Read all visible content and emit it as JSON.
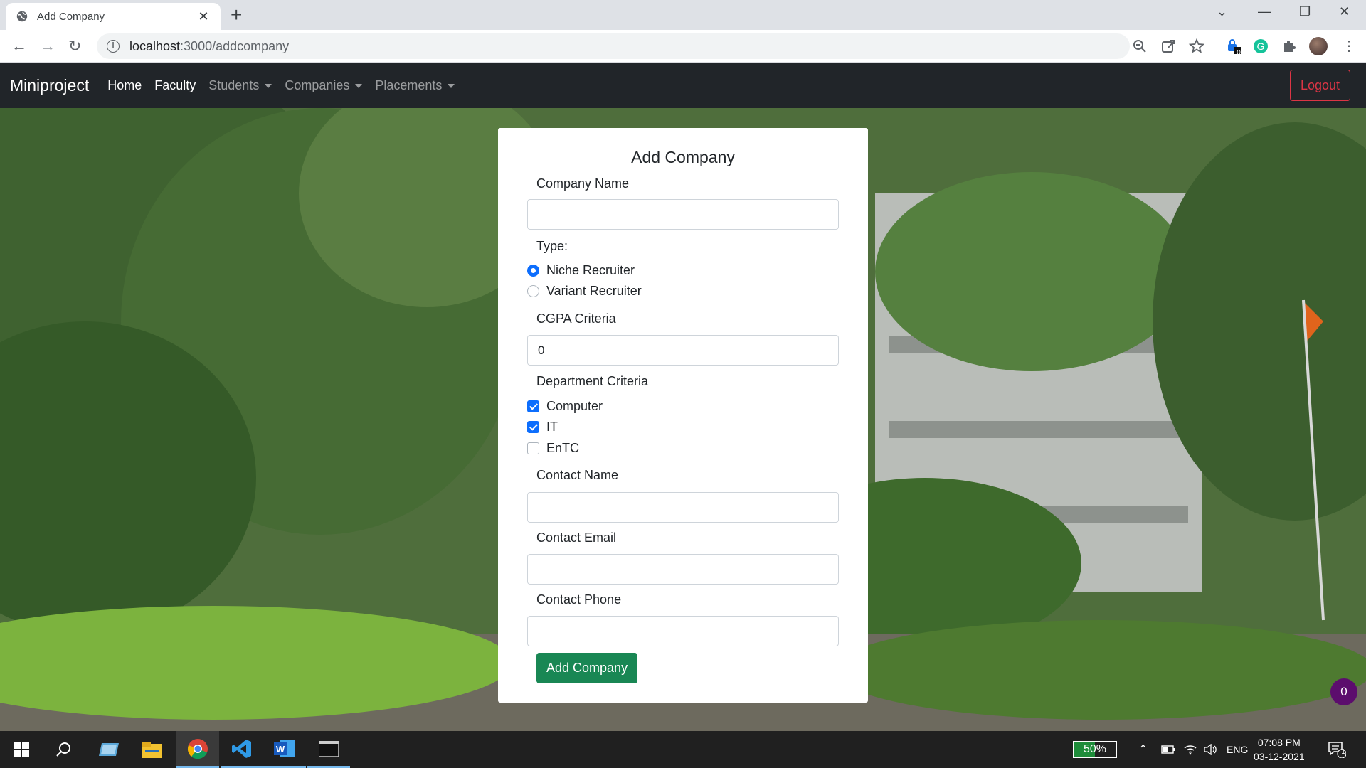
{
  "browser": {
    "tab_title": "Add Company",
    "url_host": "localhost",
    "url_rest": ":3000/addcompany",
    "extension_badge": "0"
  },
  "navbar": {
    "brand": "Miniproject",
    "links": [
      "Home",
      "Faculty",
      "Students",
      "Companies",
      "Placements"
    ],
    "logout": "Logout"
  },
  "form": {
    "title": "Add Company",
    "company_name_label": "Company Name",
    "company_name_value": "",
    "type_label": "Type:",
    "type_options": [
      "Niche Recruiter",
      "Variant Recruiter"
    ],
    "type_selected": "Niche Recruiter",
    "cgpa_label": "CGPA Criteria",
    "cgpa_value": "0",
    "department_label": "Department Criteria",
    "departments": [
      {
        "label": "Computer",
        "checked": true
      },
      {
        "label": "IT",
        "checked": true
      },
      {
        "label": "EnTC",
        "checked": false
      }
    ],
    "contact_name_label": "Contact Name",
    "contact_email_label": "Contact Email",
    "contact_phone_label": "Contact Phone",
    "submit_label": "Add Company"
  },
  "floating_badge": "0",
  "taskbar": {
    "battery": "50%",
    "language": "ENG",
    "time": "07:08 PM",
    "date": "03-12-2021",
    "notification_count": "1"
  },
  "colors": {
    "navbar_bg": "#212529",
    "primary": "#0d6efd",
    "success": "#198754",
    "danger": "#dc3545"
  }
}
